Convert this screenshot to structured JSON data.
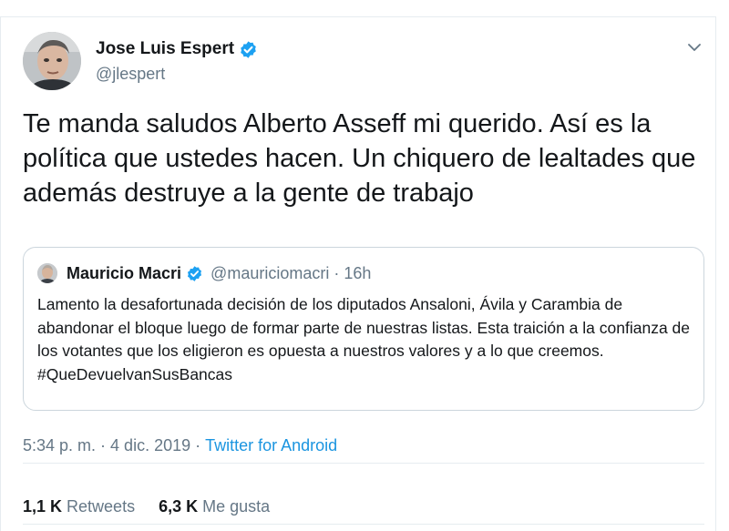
{
  "author": {
    "display_name": "Jose Luis Espert",
    "handle": "@jlespert",
    "verified": true
  },
  "tweet": {
    "text": "Te manda saludos Alberto Asseff mi querido. Así es la política que ustedes hacen. Un chiquero de lealtades que además destruye a la gente de trabajo"
  },
  "quote": {
    "display_name": "Mauricio Macri",
    "handle": "@mauriciomacri",
    "separator": "·",
    "time": "16h",
    "text": "Lamento la desafortunada decisión de los diputados Ansaloni, Ávila y Carambia de abandonar el bloque luego de formar parte de nuestras listas. Esta traición a la confianza de los votantes que los eligieron es opuesta a nuestros valores y a lo que creemos. #QueDevuelvanSusBancas"
  },
  "meta": {
    "time": "5:34 p. m.",
    "separator": "·",
    "date": "4 dic. 2019",
    "source": "Twitter for Android"
  },
  "stats": {
    "retweets_count": "1,1 K",
    "retweets_label": "Retweets",
    "likes_count": "6,3 K",
    "likes_label": "Me gusta"
  },
  "colors": {
    "verified": "#1da1f2",
    "link": "#1b95e0",
    "secondary_text": "#657786",
    "border": "#e6ecf0"
  },
  "icons": {
    "verified": "verified-badge-icon",
    "menu": "chevron-down-icon"
  }
}
